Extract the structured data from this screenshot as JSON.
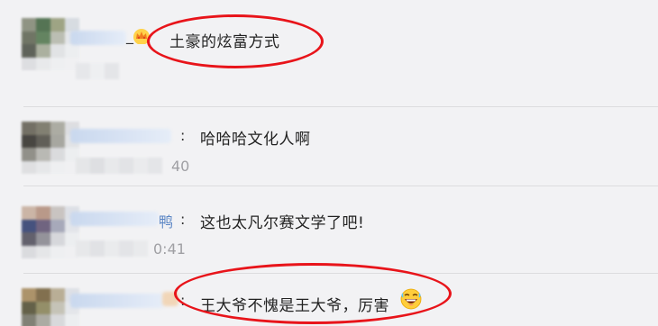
{
  "comments": [
    {
      "text": "土豪的炫富方式",
      "separator": "_ .",
      "highlighted": true
    },
    {
      "text": "哈哈哈文化人啊",
      "separator": ":",
      "time_tail": "40",
      "highlighted": false
    },
    {
      "text": "这也太凡尔赛文学了吧!",
      "separator": ":",
      "name_tail": "鸭",
      "time_tail": "0:41",
      "highlighted": false
    },
    {
      "text": "王大爷不愧是王大爷，厉害",
      "separator": ":",
      "highlighted": true
    }
  ],
  "colors": {
    "background": "#f2f2f4",
    "highlight": "#e8141a",
    "username": "#5b86c5"
  },
  "icons": [
    "crown-icon",
    "laughing-emoji-icon"
  ]
}
